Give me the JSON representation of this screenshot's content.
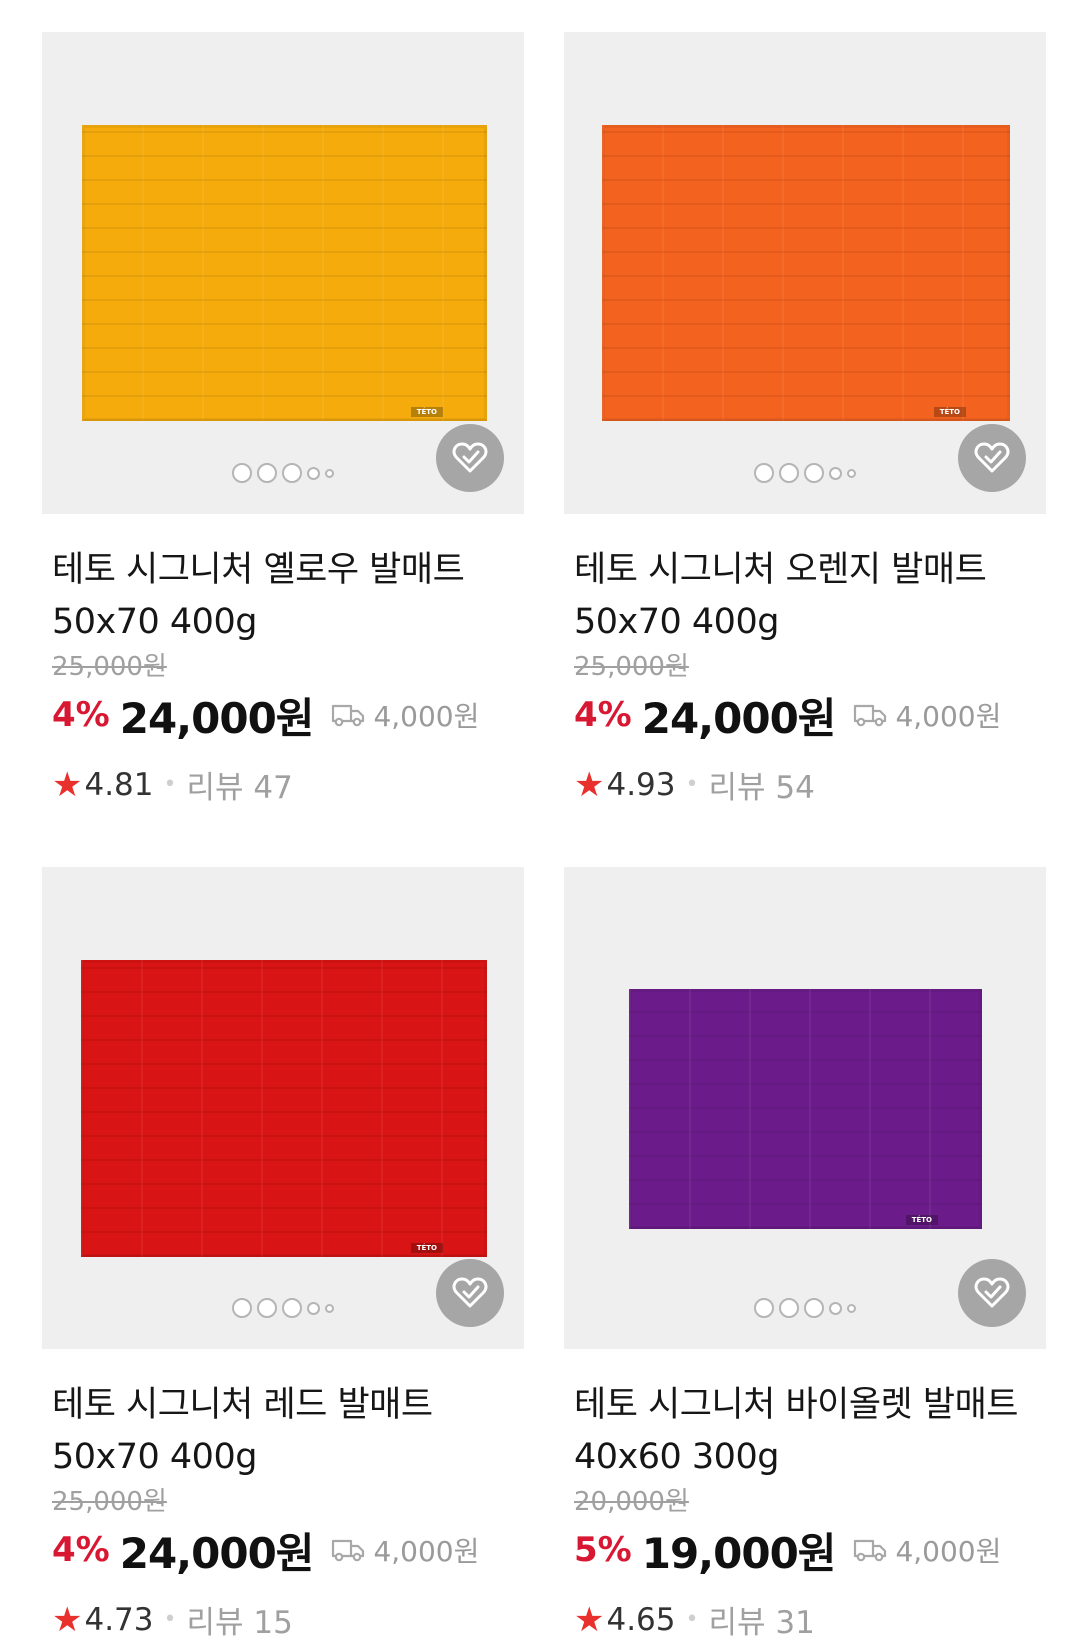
{
  "currency_unit": "원",
  "products": [
    {
      "name": "테토 시그니처 옐로우 발매트 50x70 400g",
      "original_price": "25,000원",
      "discount": "4%",
      "price": "24,000원",
      "shipping": "4,000원",
      "rating": "4.81",
      "reviews": "리뷰 47",
      "mat_color": "#f5ab0c",
      "brand_tag": "TÉTO"
    },
    {
      "name": "테토 시그니처 오렌지 발매트 50x70 400g",
      "original_price": "25,000원",
      "discount": "4%",
      "price": "24,000원",
      "shipping": "4,000원",
      "rating": "4.93",
      "reviews": "리뷰 54",
      "mat_color": "#f4621f",
      "brand_tag": "TÉTO"
    },
    {
      "name": "테토 시그니처 레드 발매트 50x70 400g",
      "original_price": "25,000원",
      "discount": "4%",
      "price": "24,000원",
      "shipping": "4,000원",
      "rating": "4.73",
      "reviews": "리뷰 15",
      "mat_color": "#d81414",
      "brand_tag": "TÉTO"
    },
    {
      "name": "테토 시그니처 바이올렛 발매트 40x60 300g",
      "original_price": "20,000원",
      "discount": "5%",
      "price": "19,000원",
      "shipping": "4,000원",
      "rating": "4.65",
      "reviews": "리뷰 31",
      "mat_color": "#6b1c8a",
      "brand_tag": "TÉTO"
    }
  ]
}
